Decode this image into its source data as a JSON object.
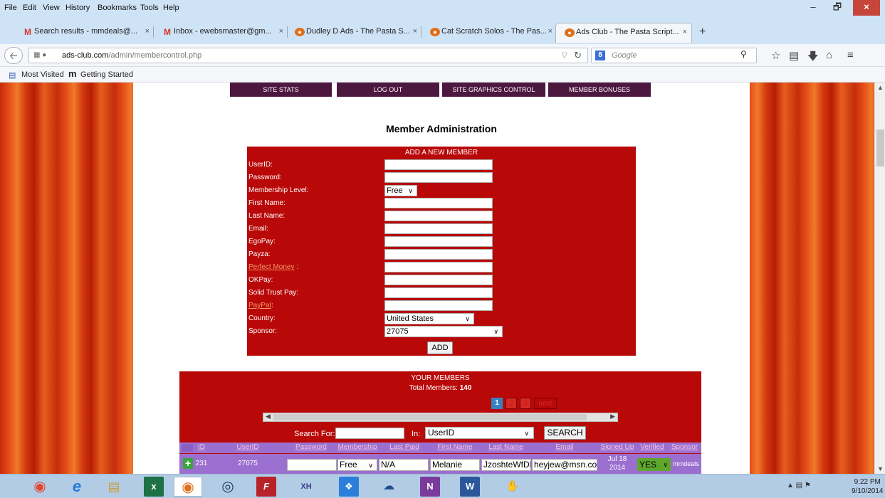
{
  "menu": [
    "File",
    "Edit",
    "View",
    "History",
    "Bookmarks",
    "Tools",
    "Help"
  ],
  "menu_accel": [
    "F",
    "E",
    "V",
    "s",
    "B",
    "T",
    "H"
  ],
  "window": {
    "minimize": "–",
    "restore": "🗗",
    "close": "×"
  },
  "tabs": [
    {
      "label": "Search results - mmdeals@...",
      "icon": "gmail-icon",
      "close": "×"
    },
    {
      "label": "Inbox - ewebsmaster@gm...",
      "icon": "gmail-icon",
      "close": "×"
    },
    {
      "label": "Dudley D Ads - The Pasta S...",
      "icon": "pasta-icon",
      "close": "×"
    },
    {
      "label": "Cat Scratch Solos - The Pas...",
      "icon": "pasta-icon",
      "close": "×"
    },
    {
      "label": "Ads Club - The Pasta Script...",
      "icon": "pasta-icon",
      "close": "×"
    }
  ],
  "new_tab": "+",
  "address": {
    "host": "ads-club.com",
    "path": "/admin/membercontrol.php"
  },
  "search": {
    "placeholder": "Google"
  },
  "bookmarks": [
    "Most Visited",
    "Getting Started"
  ],
  "topnav": [
    "SITE STATS",
    "LOG OUT",
    "SITE GRAPHICS CONTROL",
    "MEMBER BONUSES"
  ],
  "page_title": "Member Administration",
  "add_form": {
    "header": "ADD A NEW MEMBER",
    "fields": [
      {
        "label": "UserID:"
      },
      {
        "label": "Password:"
      },
      {
        "label": "Membership Level:",
        "value": "Free"
      },
      {
        "label": "First Name:"
      },
      {
        "label": "Last Name:"
      },
      {
        "label": "Email:"
      },
      {
        "label": "EgoPay:"
      },
      {
        "label": "Payza:"
      },
      {
        "label": "Perfect Money",
        "link": true
      },
      {
        "label": "OKPay:"
      },
      {
        "label": "Solid Trust Pay:"
      },
      {
        "label": "PayPal",
        "link": true
      },
      {
        "label": "Country:",
        "value": "United States"
      },
      {
        "label": "Sponsor:",
        "value": "27075"
      }
    ],
    "colon": ":",
    "add_button": "ADD"
  },
  "members": {
    "header": "YOUR MEMBERS",
    "total_label": "Total Members:",
    "total": "140",
    "pages": [
      "1",
      "2",
      "3",
      "next"
    ],
    "search_for": "Search For:",
    "in_label": "In:",
    "in_value": "UserID",
    "search_button": "SEARCH",
    "columns": [
      "ID",
      "UserID",
      "Password",
      "Membership",
      "Last Paid",
      "First Name",
      "Last Name",
      "Email",
      "Signed Up",
      "Verified",
      "Sponsor"
    ],
    "rows": [
      {
        "id": "231",
        "userid": "27075",
        "password": "",
        "membership": "Free",
        "last_paid": "N/A",
        "first_name": "Melanie",
        "last_name": "JzoshteWfDl",
        "email": "heyjew@msn.co",
        "signed_up_1": "Jul 18",
        "signed_up_2": "2014",
        "verified": "YES",
        "sponsor": "mmdeals"
      }
    ]
  },
  "taskbar": {
    "time": "9:22 PM",
    "date": "9/10/2014"
  },
  "colors": {
    "accent_red": "#b90808",
    "nav_purple": "#4d1840",
    "table_purple": "#9b6fcf",
    "page_current": "#3582c1"
  }
}
